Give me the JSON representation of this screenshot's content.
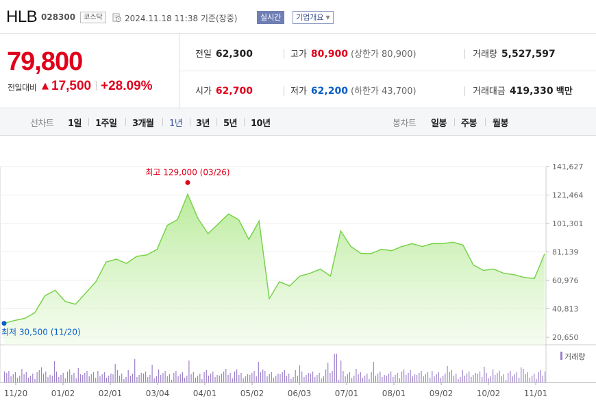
{
  "header": {
    "name": "HLB",
    "code": "028300",
    "market": "코스닥",
    "timestamp": "2024.11.18 11:38  기준(장중)",
    "realtime_label": "실시간",
    "company_info_label": "기업개요"
  },
  "price": {
    "current": "79,800",
    "change_label": "전일대비",
    "change_icon": "up-triangle-icon",
    "change_value": "17,500",
    "change_percent": "+28.09%"
  },
  "stats": {
    "prev_close": {
      "label": "전일",
      "value": "62,300"
    },
    "high": {
      "label": "고가",
      "value": "80,900",
      "sub": "(상한가 80,900)"
    },
    "volume": {
      "label": "거래량",
      "value": "5,527,597"
    },
    "open": {
      "label": "시가",
      "value": "62,700"
    },
    "low": {
      "label": "저가",
      "value": "62,200",
      "sub": "(하한가 43,700)"
    },
    "amount": {
      "label": "거래대금",
      "value": "419,330",
      "unit": "백만"
    }
  },
  "tabs": {
    "line_chart_label": "선차트",
    "periods": [
      "1일",
      "1주일",
      "3개월",
      "1년",
      "3년",
      "5년",
      "10년"
    ],
    "selected_period": "1년",
    "candle_label": "봉차트",
    "candles": [
      "일봉",
      "주봉",
      "월봉"
    ]
  },
  "colors": {
    "up": "#e0001b",
    "down": "#0a5ec8",
    "accent": "#3f54a4",
    "line": "#78d34a",
    "volume": "#9b7fc9"
  },
  "chart_data": {
    "type": "area",
    "x": [
      "11/20",
      "11/27",
      "12/04",
      "12/11",
      "12/18",
      "12/26",
      "01/02",
      "01/09",
      "01/16",
      "01/23",
      "01/30",
      "02/06",
      "02/13",
      "02/20",
      "02/27",
      "03/05",
      "03/12",
      "03/19",
      "03/26",
      "04/02",
      "04/09",
      "04/16",
      "04/23",
      "04/30",
      "05/07",
      "05/14",
      "05/17",
      "05/24",
      "05/31",
      "06/07",
      "06/14",
      "06/21",
      "06/28",
      "07/05",
      "07/12",
      "07/19",
      "07/26",
      "08/02",
      "08/09",
      "08/16",
      "08/23",
      "08/30",
      "09/06",
      "09/13",
      "09/20",
      "09/27",
      "10/04",
      "10/11",
      "10/18",
      "10/25",
      "11/01",
      "11/08",
      "11/15",
      "11/18"
    ],
    "values": [
      30500,
      32500,
      34000,
      38000,
      50000,
      54000,
      46000,
      44000,
      52000,
      60000,
      74000,
      76000,
      73000,
      78000,
      79000,
      83000,
      100000,
      104000,
      122000,
      105000,
      94000,
      101000,
      108000,
      104000,
      90000,
      103000,
      48000,
      60000,
      57000,
      64000,
      66000,
      69000,
      64000,
      96000,
      85000,
      80000,
      80000,
      83000,
      82000,
      85000,
      87000,
      85000,
      87000,
      87000,
      88000,
      86000,
      72000,
      68000,
      69000,
      66000,
      65000,
      63000,
      62300,
      79800
    ],
    "yticks": [
      "141,627",
      "121,464",
      "101,301",
      "81,139",
      "60,976",
      "40,813",
      "20,650"
    ],
    "ylim": [
      20650,
      141627
    ],
    "xticks": [
      "11/20",
      "01/02",
      "02/01",
      "03/04",
      "04/01",
      "05/02",
      "06/03",
      "07/01",
      "08/01",
      "09/02",
      "10/02",
      "11/01"
    ],
    "max_label": "최고 129,000 (03/26)",
    "min_label": "최저  30,500 (11/20)",
    "volume_label": "거래량"
  }
}
